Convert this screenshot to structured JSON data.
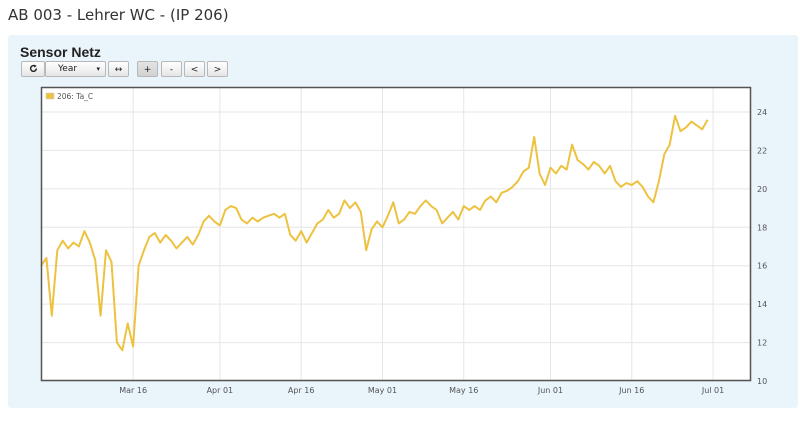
{
  "page": {
    "title": "AB 003 - Lehrer WC - (IP 206)"
  },
  "panel": {
    "title": "Sensor Netz"
  },
  "toolbar": {
    "refresh_icon": "refresh-icon",
    "range_select": {
      "value": "Year",
      "caret": "▾"
    },
    "expand_label": "↔",
    "zoom_in_label": "+",
    "zoom_out_label": "-",
    "prev_label": "<",
    "next_label": ">"
  },
  "chart_data": {
    "type": "line",
    "series": [
      {
        "name": "206: Ta_C",
        "color": "#edc240",
        "points": [
          [
            "2016-02-28",
            16.0
          ],
          [
            "2016-02-29",
            16.4
          ],
          [
            "2016-03-01",
            13.4
          ],
          [
            "2016-03-02",
            16.8
          ],
          [
            "2016-03-03",
            17.3
          ],
          [
            "2016-03-04",
            16.9
          ],
          [
            "2016-03-05",
            17.2
          ],
          [
            "2016-03-06",
            17.0
          ],
          [
            "2016-03-07",
            17.8
          ],
          [
            "2016-03-08",
            17.2
          ],
          [
            "2016-03-09",
            16.3
          ],
          [
            "2016-03-10",
            13.4
          ],
          [
            "2016-03-11",
            16.8
          ],
          [
            "2016-03-12",
            16.2
          ],
          [
            "2016-03-13",
            12.0
          ],
          [
            "2016-03-14",
            11.6
          ],
          [
            "2016-03-15",
            13.0
          ],
          [
            "2016-03-16",
            11.8
          ],
          [
            "2016-03-17",
            16.0
          ],
          [
            "2016-03-18",
            16.8
          ],
          [
            "2016-03-19",
            17.5
          ],
          [
            "2016-03-20",
            17.7
          ],
          [
            "2016-03-21",
            17.2
          ],
          [
            "2016-03-22",
            17.6
          ],
          [
            "2016-03-23",
            17.3
          ],
          [
            "2016-03-24",
            16.9
          ],
          [
            "2016-03-25",
            17.2
          ],
          [
            "2016-03-26",
            17.5
          ],
          [
            "2016-03-27",
            17.1
          ],
          [
            "2016-03-28",
            17.6
          ],
          [
            "2016-03-29",
            18.3
          ],
          [
            "2016-03-30",
            18.6
          ],
          [
            "2016-03-31",
            18.3
          ],
          [
            "2016-04-01",
            18.1
          ],
          [
            "2016-04-02",
            18.9
          ],
          [
            "2016-04-03",
            19.1
          ],
          [
            "2016-04-04",
            19.0
          ],
          [
            "2016-04-05",
            18.4
          ],
          [
            "2016-04-06",
            18.2
          ],
          [
            "2016-04-07",
            18.5
          ],
          [
            "2016-04-08",
            18.3
          ],
          [
            "2016-04-09",
            18.5
          ],
          [
            "2016-04-10",
            18.6
          ],
          [
            "2016-04-11",
            18.7
          ],
          [
            "2016-04-12",
            18.5
          ],
          [
            "2016-04-13",
            18.7
          ],
          [
            "2016-04-14",
            17.6
          ],
          [
            "2016-04-15",
            17.3
          ],
          [
            "2016-04-16",
            17.8
          ],
          [
            "2016-04-17",
            17.2
          ],
          [
            "2016-04-18",
            17.7
          ],
          [
            "2016-04-19",
            18.2
          ],
          [
            "2016-04-20",
            18.4
          ],
          [
            "2016-04-21",
            18.9
          ],
          [
            "2016-04-22",
            18.5
          ],
          [
            "2016-04-23",
            18.7
          ],
          [
            "2016-04-24",
            19.4
          ],
          [
            "2016-04-25",
            19.0
          ],
          [
            "2016-04-26",
            19.3
          ],
          [
            "2016-04-27",
            18.8
          ],
          [
            "2016-04-28",
            16.8
          ],
          [
            "2016-04-29",
            17.9
          ],
          [
            "2016-04-30",
            18.3
          ],
          [
            "2016-05-01",
            18.0
          ],
          [
            "2016-05-02",
            18.6
          ],
          [
            "2016-05-03",
            19.3
          ],
          [
            "2016-05-04",
            18.2
          ],
          [
            "2016-05-05",
            18.4
          ],
          [
            "2016-05-06",
            18.8
          ],
          [
            "2016-05-07",
            18.7
          ],
          [
            "2016-05-08",
            19.1
          ],
          [
            "2016-05-09",
            19.4
          ],
          [
            "2016-05-10",
            19.1
          ],
          [
            "2016-05-11",
            18.9
          ],
          [
            "2016-05-12",
            18.2
          ],
          [
            "2016-05-13",
            18.5
          ],
          [
            "2016-05-14",
            18.8
          ],
          [
            "2016-05-15",
            18.4
          ],
          [
            "2016-05-16",
            19.1
          ],
          [
            "2016-05-17",
            18.9
          ],
          [
            "2016-05-18",
            19.1
          ],
          [
            "2016-05-19",
            18.9
          ],
          [
            "2016-05-20",
            19.4
          ],
          [
            "2016-05-21",
            19.6
          ],
          [
            "2016-05-22",
            19.3
          ],
          [
            "2016-05-23",
            19.8
          ],
          [
            "2016-05-24",
            19.9
          ],
          [
            "2016-05-25",
            20.1
          ],
          [
            "2016-05-26",
            20.4
          ],
          [
            "2016-05-27",
            20.9
          ],
          [
            "2016-05-28",
            21.1
          ],
          [
            "2016-05-29",
            22.7
          ],
          [
            "2016-05-30",
            20.8
          ],
          [
            "2016-05-31",
            20.2
          ],
          [
            "2016-06-01",
            21.1
          ],
          [
            "2016-06-02",
            20.8
          ],
          [
            "2016-06-03",
            21.2
          ],
          [
            "2016-06-04",
            21.0
          ],
          [
            "2016-06-05",
            22.3
          ],
          [
            "2016-06-06",
            21.5
          ],
          [
            "2016-06-07",
            21.3
          ],
          [
            "2016-06-08",
            21.0
          ],
          [
            "2016-06-09",
            21.4
          ],
          [
            "2016-06-10",
            21.2
          ],
          [
            "2016-06-11",
            20.8
          ],
          [
            "2016-06-12",
            21.2
          ],
          [
            "2016-06-13",
            20.4
          ],
          [
            "2016-06-14",
            20.1
          ],
          [
            "2016-06-15",
            20.3
          ],
          [
            "2016-06-16",
            20.2
          ],
          [
            "2016-06-17",
            20.4
          ],
          [
            "2016-06-18",
            20.1
          ],
          [
            "2016-06-19",
            19.6
          ],
          [
            "2016-06-20",
            19.3
          ],
          [
            "2016-06-21",
            20.4
          ],
          [
            "2016-06-22",
            21.8
          ],
          [
            "2016-06-23",
            22.3
          ],
          [
            "2016-06-24",
            23.8
          ],
          [
            "2016-06-25",
            23.0
          ],
          [
            "2016-06-26",
            23.2
          ],
          [
            "2016-06-27",
            23.5
          ],
          [
            "2016-06-28",
            23.3
          ],
          [
            "2016-06-29",
            23.1
          ],
          [
            "2016-06-30",
            23.6
          ]
        ]
      }
    ],
    "x_ticks": [
      "Mar 16",
      "Apr 01",
      "Apr 16",
      "May 01",
      "May 16",
      "Jun 01",
      "Jun 16",
      "Jul 01"
    ],
    "x_tick_dates": [
      "2016-03-16",
      "2016-04-01",
      "2016-04-16",
      "2016-05-01",
      "2016-05-16",
      "2016-06-01",
      "2016-06-16",
      "2016-07-01"
    ],
    "xlim": [
      "2016-02-28",
      "2016-07-08"
    ],
    "y_ticks": [
      "10",
      "12",
      "14",
      "16",
      "18",
      "20",
      "22",
      "24"
    ],
    "ylim": [
      10,
      25.3
    ],
    "y_axis_side": "right",
    "grid": true,
    "legend_position": "top-left"
  }
}
